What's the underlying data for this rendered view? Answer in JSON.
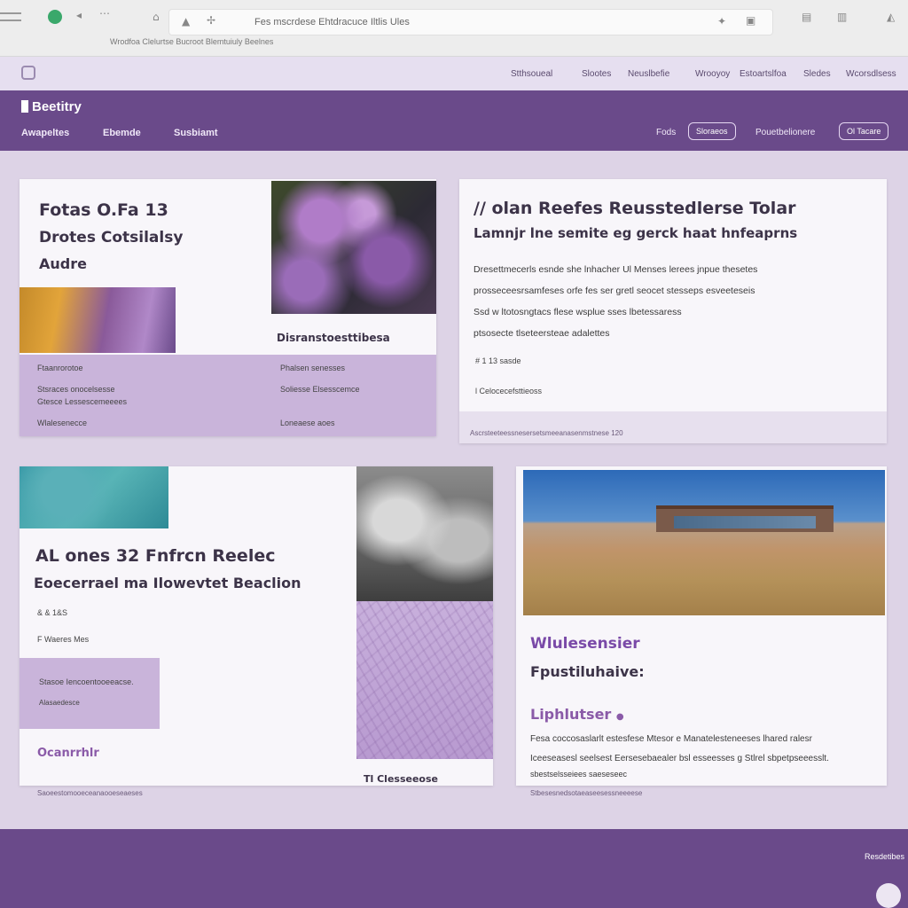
{
  "browser": {
    "url": "Fes mscrdese Ehtdracuce Iltlis Ules",
    "bookmarks": "Wrodfoa Clelurtse Bucroot Blemtuiuly Beelnes"
  },
  "utility_nav": [
    "Stthsoueal",
    "Slootes",
    "Neuslbefie",
    "Wrooyoy",
    "Estoartslfoa",
    "Sledes",
    "Wcorsdlsess"
  ],
  "main_nav": {
    "brand": "Beetitry",
    "links": [
      "Awapeltes",
      "Ebemde",
      "Susbiamt"
    ],
    "right_links": [
      "Fods",
      "Sloraeos",
      "Pouetbelionere",
      "Ol Tacare"
    ]
  },
  "card1": {
    "heading": [
      "Fotas O.Fa 13",
      "Drotes Cotsilalsy",
      "Audre"
    ],
    "caption": "Disranstoesttibesa",
    "lav_left": [
      "Ftaanrorotoe",
      "Stsraces onocelsesse",
      "Gtesce Lessescemeeees",
      "Wlalesenecce"
    ],
    "lav_right": [
      "Phalsen senesses",
      "Soliesse Elsesscemce",
      "Loneaese aoes"
    ]
  },
  "card2": {
    "heading": [
      "// olan Reefes Reusstedlerse Tolar",
      "Lamnjr lne semite eg gerck haat hnfeaprns"
    ],
    "body": [
      "Dresettmecerls esnde she lnhacher Ul Menses lerees jnpue thesetes",
      "prosseceesrsamfeses orfe fes ser gretl seocet stesseps esveeteseis",
      "Ssd w ltotosngtacs flese wsplue sses lbetessaress",
      "ptsosecte tlseteersteae adalettes"
    ],
    "meta": "# 1 13 sasde",
    "meta2": "l Celocecefsttieoss",
    "footer": "Ascrsteeteessnesersetsmeeanasenmstnese 120"
  },
  "card3": {
    "heading": [
      "AL ones 32 Fnfrcn Reelec",
      "Eoecerrael ma Ilowevtet Beaclion"
    ],
    "meta": "& & 1&S",
    "meta2": "F Waeres Mes",
    "lav": [
      "Stasoe Iencoentooeeacse.",
      "Alasaedesce"
    ],
    "link": "Ocanrrhlr",
    "caption": "Tl Clesseeose",
    "footer": "Saoeestomooeceanaooeseaeses"
  },
  "card4": {
    "heading": [
      "Wlulesensier",
      "Fpustiluhaive:"
    ],
    "sub": "Liphlutser",
    "body": [
      "Fesa coccosaslarlt estesfese Mtesor e Manatelesteneeses lhared ralesr",
      "Iceeseasesl seelsest Eersesebaealer bsl esseesses g Stlrel sbpetpseeesslt.",
      "sbestselsseiees saeseseec"
    ],
    "footer": "Stbesesnedsotaeaseesessneeeese"
  },
  "footer": {
    "text": "Resdetibes"
  },
  "colors": {
    "primary": "#6a4a8a",
    "lavender": "#c9b4da",
    "background": "#ddd3e6"
  }
}
